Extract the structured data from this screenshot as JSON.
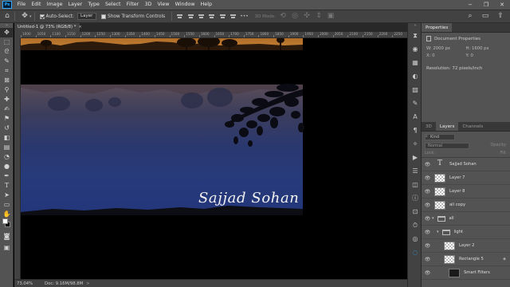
{
  "app": {
    "logo_text": "Ps",
    "menu": [
      "File",
      "Edit",
      "Image",
      "Layer",
      "Type",
      "Select",
      "Filter",
      "3D",
      "View",
      "Window",
      "Help"
    ],
    "window_controls": [
      "−",
      "❐",
      "✕"
    ]
  },
  "options_bar": {
    "auto_select_label": "Auto-Select:",
    "auto_select_checked": true,
    "layer_select_value": "Layer",
    "show_transform_label": "Show Transform Controls",
    "show_transform_checked": false,
    "mode_3d_label": "3D Mode:"
  },
  "tools": [
    "move-tool",
    "marquee-tool",
    "lasso-tool",
    "quick-selection-tool",
    "crop-tool",
    "frame-tool",
    "eyedropper-tool",
    "healing-brush-tool",
    "brush-tool",
    "clone-stamp-tool",
    "history-brush-tool",
    "eraser-tool",
    "gradient-tool",
    "blur-tool",
    "dodge-tool",
    "pen-tool",
    "type-tool",
    "path-selection-tool",
    "rectangle-tool",
    "hand-tool",
    "zoom-tool"
  ],
  "document": {
    "tab_title": "Untitled-1 @ 73% (RGB/8) *",
    "tab_close": "×",
    "ruler_labels": [
      "1000",
      "1050",
      "1100",
      "1150",
      "1200",
      "1250",
      "1300",
      "1350",
      "1400",
      "1450",
      "1500",
      "1550",
      "1600",
      "1650",
      "1700",
      "1750",
      "1800",
      "1850",
      "1900",
      "1950",
      "2000",
      "2050",
      "2100",
      "2150",
      "2200",
      "2250"
    ],
    "canvas_text": "Sajjad Sohan"
  },
  "status": {
    "zoom": "73.04%",
    "doc_info": "Doc: 9.16M/98.8M",
    "arrow": ">"
  },
  "properties_panel": {
    "tab_label": "Properties",
    "doc_label": "Document Properties",
    "width_label": "W:",
    "width_value": "2000 px",
    "height_label": "H:",
    "height_value": "1600 px",
    "x_label": "X:",
    "x_value": "0",
    "y_label": "Y:",
    "y_value": "0",
    "resolution_text": "Resolution: 72 pixels/inch"
  },
  "layers_panel": {
    "tabs": [
      "3D",
      "Layers",
      "Channels"
    ],
    "active_tab": "Layers",
    "kind_placeholder": "Kind",
    "blend_mode": "Normal",
    "opacity_label": "Opacity:",
    "lock_label": "Lock:",
    "fill_label": "Fill:",
    "layers": [
      {
        "name": "Sajjad Sohan",
        "thumb": "text",
        "indent": 0,
        "fx": false
      },
      {
        "name": "Layer 7",
        "thumb": "check",
        "indent": 0,
        "fx": false
      },
      {
        "name": "Layer 8",
        "thumb": "check",
        "indent": 0,
        "fx": false
      },
      {
        "name": "all copy",
        "thumb": "check",
        "indent": 0,
        "fx": false
      },
      {
        "name": "all",
        "thumb": "folder",
        "indent": 0,
        "fx": false
      },
      {
        "name": "light",
        "thumb": "folder",
        "indent": 1,
        "fx": false
      },
      {
        "name": "Layer 2",
        "thumb": "check",
        "indent": 2,
        "fx": false
      },
      {
        "name": "Rectangle 5",
        "thumb": "check",
        "indent": 2,
        "fx": true
      },
      {
        "name": "Smart Filters",
        "thumb": "dark",
        "indent": 3,
        "fx": false
      }
    ]
  },
  "colors": {
    "ui_dark": "#282828",
    "ui_mid": "#424242",
    "ui_light": "#535353",
    "sky_orange": "#c98234",
    "water_blue": "#273a7a",
    "accent_blue": "#31a8ff"
  }
}
